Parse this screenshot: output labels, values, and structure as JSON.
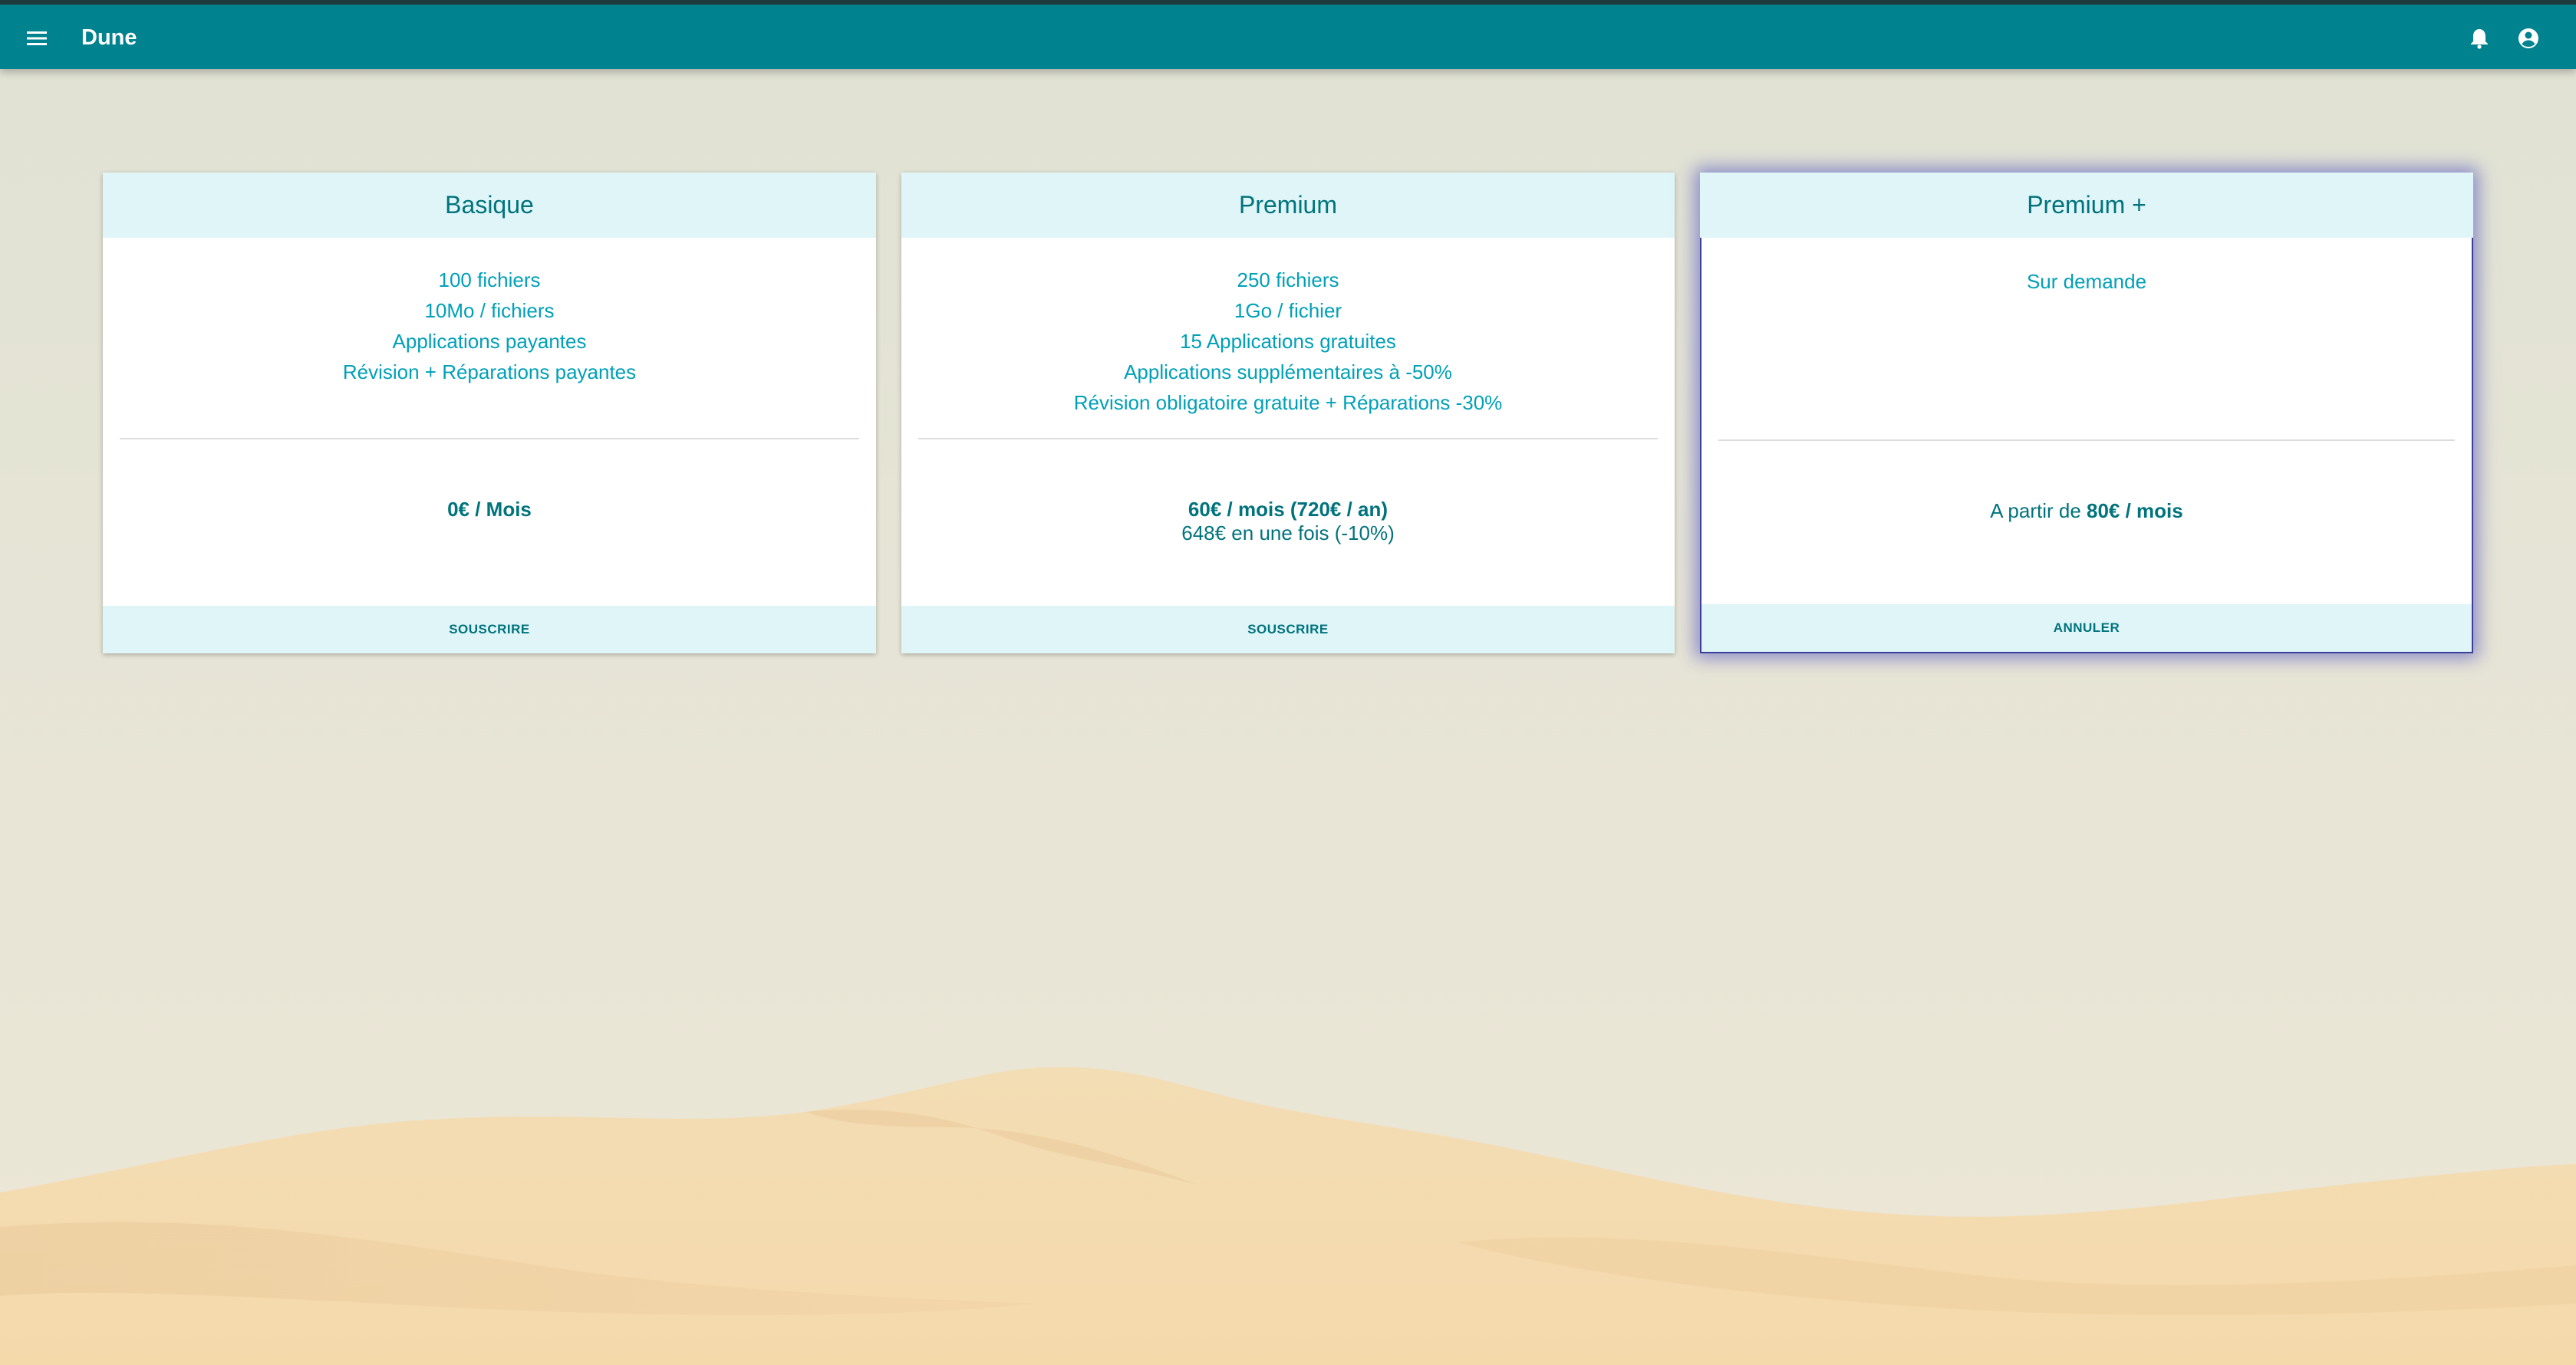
{
  "app": {
    "title": "Dune",
    "icons": {
      "menu": "menu-icon",
      "notifications": "bell-icon",
      "account": "account-circle-icon"
    },
    "colors": {
      "toolbar": "#00838f",
      "card_accent": "#dff5f8",
      "feature_text": "#00a0b8",
      "price_text": "#00737d",
      "selected_outline": "#3a3f9a"
    }
  },
  "plans": [
    {
      "name": "Basique",
      "features": [
        "100 fichiers",
        "10Mo / fichiers",
        "Applications payantes",
        "Révision + Réparations payantes"
      ],
      "price_prefix": "",
      "price_main": "0€ / Mois",
      "price_sub": "",
      "action": "SOUSCRIRE"
    },
    {
      "name": "Premium",
      "features": [
        "250 fichiers",
        "1Go / fichier",
        "15 Applications gratuites",
        "Applications supplémentaires à -50%",
        "Révision obligatoire gratuite + Réparations -30%"
      ],
      "price_prefix": "",
      "price_main": "60€ / mois (720€ / an)",
      "price_sub": "648€ en une fois (-10%)",
      "action": "SOUSCRIRE"
    },
    {
      "name": "Premium +",
      "features": [
        "Sur demande"
      ],
      "price_prefix": "A partir de ",
      "price_main": "80€ / mois",
      "price_sub": "",
      "action": "ANNULER"
    }
  ]
}
